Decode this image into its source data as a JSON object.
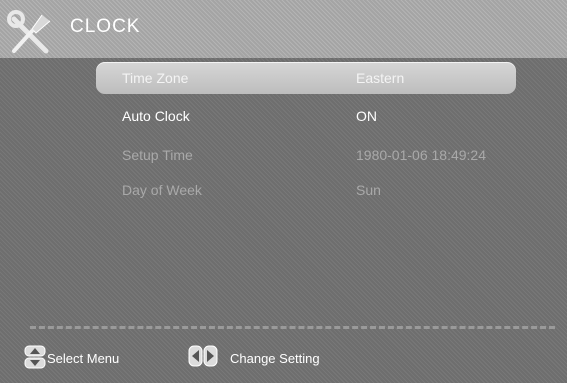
{
  "header": {
    "title": "CLOCK",
    "icon": "tools-icon"
  },
  "menu": {
    "rows": [
      {
        "label": "Time Zone",
        "value": "Eastern",
        "state": "selected"
      },
      {
        "label": "Auto Clock",
        "value": "ON",
        "state": "active"
      },
      {
        "label": "Setup Time",
        "value": "1980-01-06 18:49:24",
        "state": "disabled"
      },
      {
        "label": "Day of Week",
        "value": "Sun",
        "state": "disabled"
      }
    ]
  },
  "footer": {
    "select_menu": {
      "icon": "up-down-arrows-icon",
      "label": "Select Menu"
    },
    "change_setting": {
      "icon": "left-right-arrows-icon",
      "label": "Change Setting"
    }
  },
  "colors": {
    "background": "#6e6e6e",
    "header": "#a4a4a4",
    "selection": "#c9c9c9",
    "text_active": "#ffffff",
    "text_disabled": "#a9a9a9"
  }
}
